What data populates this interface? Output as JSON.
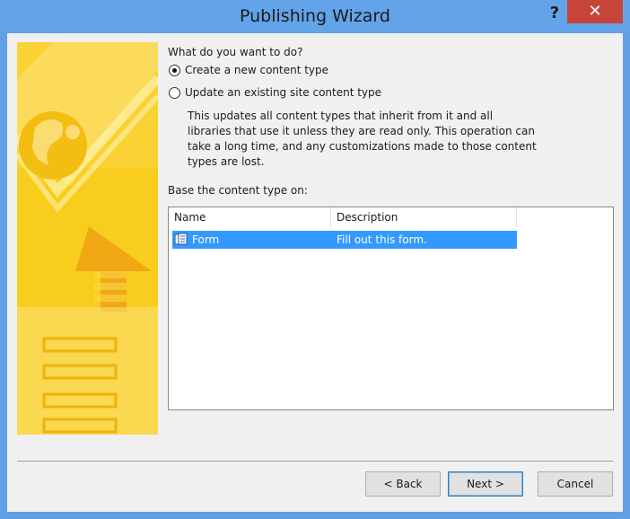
{
  "window": {
    "title": "Publishing Wizard",
    "help_label": "?",
    "close_label": "✕"
  },
  "question": "What do you want to do?",
  "options": [
    {
      "label": "Create a new content type",
      "selected": true
    },
    {
      "label": "Update an existing site content type",
      "selected": false
    }
  ],
  "description": "This updates all content types that inherit from it and all libraries that use it unless they are read only. This operation can take a long time, and any customizations made to those content types are lost.",
  "base_label": "Base the content type on:",
  "list": {
    "columns": [
      "Name",
      "Description"
    ],
    "rows": [
      {
        "name": "Form",
        "description": "Fill out this form.",
        "icon": "form-icon",
        "selected": true
      }
    ]
  },
  "buttons": {
    "back": "< Back",
    "next": "Next >",
    "cancel": "Cancel"
  },
  "colors": {
    "titlebar": "#62a3e9",
    "close": "#c7443a",
    "selection": "#3399ff",
    "side_image": "#f8c81a"
  }
}
